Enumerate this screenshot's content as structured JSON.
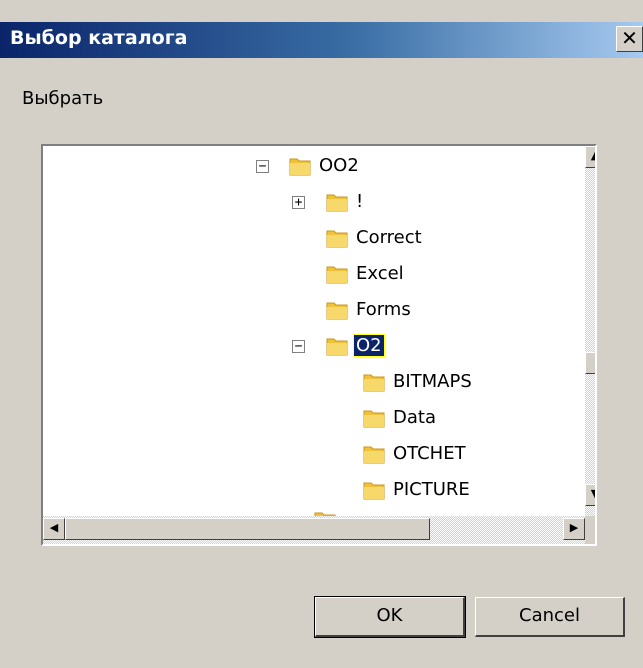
{
  "dialog": {
    "title": "Выбор каталога",
    "close_glyph": "✕",
    "prompt": "Выбрать"
  },
  "tree": {
    "rows": [
      {
        "label": "OO2",
        "expander": "−",
        "selected": false
      },
      {
        "label": "!",
        "expander": "+",
        "selected": false
      },
      {
        "label": "Correct",
        "expander": "",
        "selected": false
      },
      {
        "label": "Excel",
        "expander": "",
        "selected": false
      },
      {
        "label": "Forms",
        "expander": "",
        "selected": false
      },
      {
        "label": "O2",
        "expander": "−",
        "selected": true
      },
      {
        "label": "BITMAPS",
        "expander": "",
        "selected": false
      },
      {
        "label": "Data",
        "expander": "",
        "selected": false
      },
      {
        "label": "OTCHET",
        "expander": "",
        "selected": false
      },
      {
        "label": "PICTURE",
        "expander": "",
        "selected": false
      }
    ]
  },
  "scrollbars": {
    "up_glyph": "▲",
    "down_glyph": "▼",
    "left_glyph": "◀",
    "right_glyph": "▶"
  },
  "buttons": {
    "ok_label": "OK",
    "cancel_label": "Cancel"
  },
  "colors": {
    "selection": "#0a246a",
    "folder": "#f0c23a"
  },
  "icons": {
    "folder": "folder-icon",
    "expand": "plus-box-icon",
    "collapse": "minus-box-icon"
  }
}
